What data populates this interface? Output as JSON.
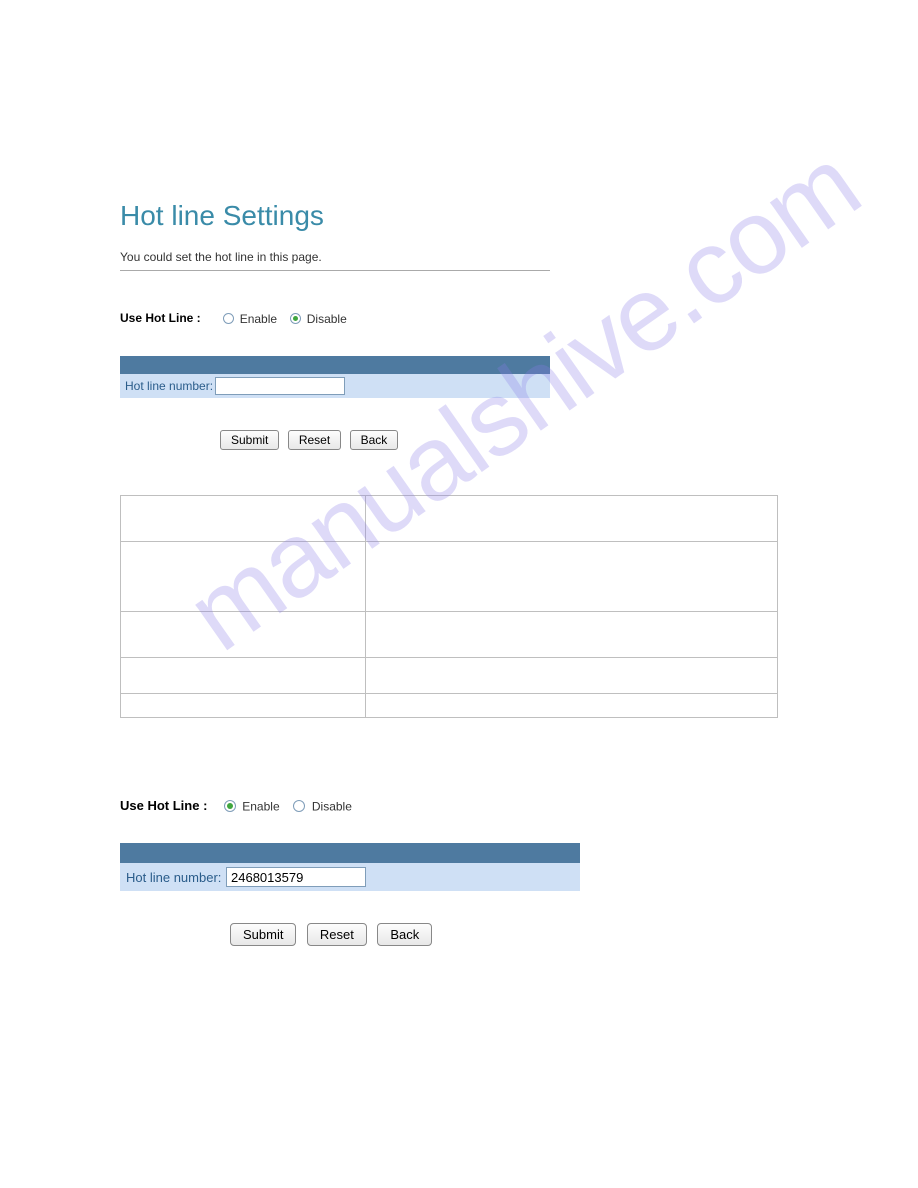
{
  "watermark": "manualshive.com",
  "section1": {
    "title": "Hot line Settings",
    "description": "You could set the hot line in this page.",
    "use_hot_line_label": "Use Hot Line :",
    "enable_label": "Enable",
    "disable_label": "Disable",
    "selected": "disable",
    "hot_line_number_label": "Hot line number:",
    "hot_line_number_value": "",
    "submit_label": "Submit",
    "reset_label": "Reset",
    "back_label": "Back"
  },
  "section2": {
    "use_hot_line_label": "Use Hot Line :",
    "enable_label": "Enable",
    "disable_label": "Disable",
    "selected": "enable",
    "hot_line_number_label": "Hot line number:",
    "hot_line_number_value": "2468013579",
    "submit_label": "Submit",
    "reset_label": "Reset",
    "back_label": "Back"
  }
}
